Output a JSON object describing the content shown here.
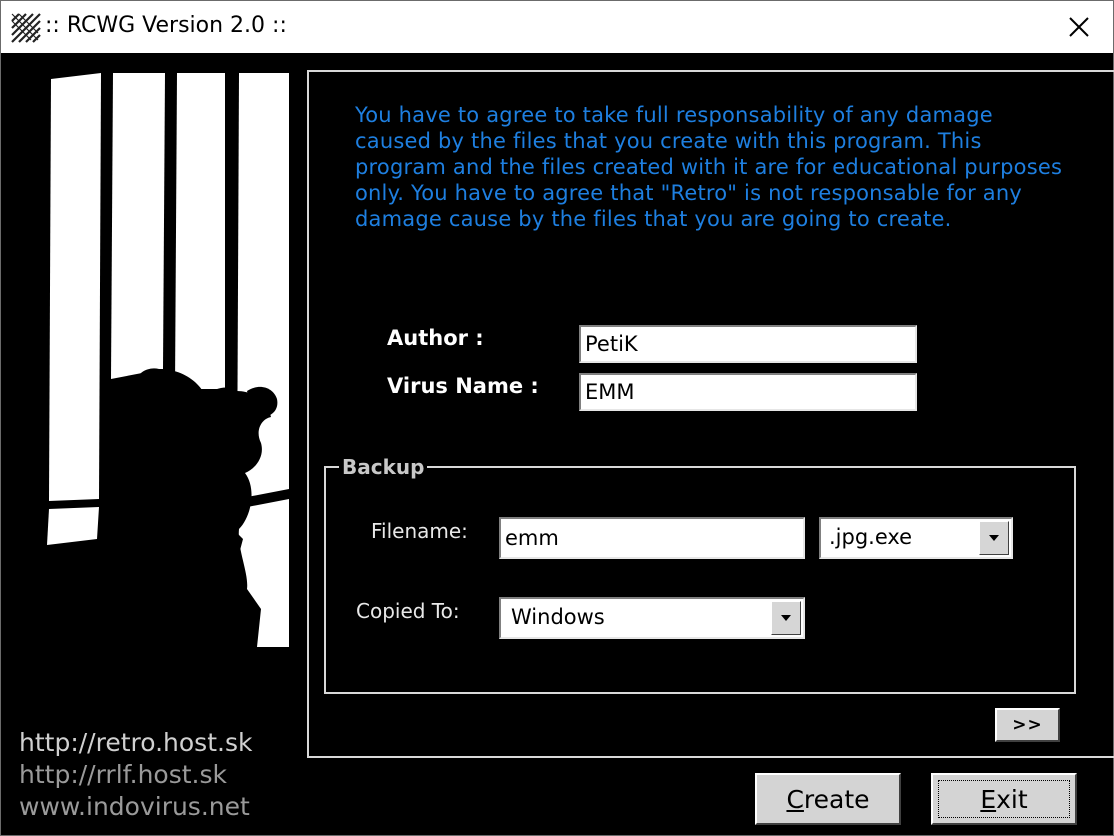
{
  "window": {
    "title": ":: RCWG Version 2.0 ::",
    "title_icon": "rcwg-app-icon",
    "close_icon": "close-icon"
  },
  "disclaimer": "You have to agree to take full responsability of any damage caused by the files that you create with this program. This program and the files created with it are for educational purposes only. You have to agree that \"Retro\" is not responsable for any damage cause by the files that you are going to create.",
  "form": {
    "author_label": "Author :",
    "author_value": "PetiK",
    "virus_name_label": "Virus Name :",
    "virus_name_value": "EMM"
  },
  "backup": {
    "group_title": "Backup",
    "filename_label": "Filename:",
    "filename_value": "emm",
    "extension_selected": ".jpg.exe",
    "copied_to_label": "Copied To:",
    "copied_to_selected": "Windows"
  },
  "buttons": {
    "next_label": ">>",
    "create_label_first": "C",
    "create_label_rest": "reate",
    "exit_label_first": "E",
    "exit_label_rest": "xit"
  },
  "links": {
    "link1": "http://retro.host.sk",
    "link2": "http://rrlf.host.sk",
    "link3": "www.indovirus.net"
  },
  "colors": {
    "disclaimer_text": "#1e7fe0",
    "background": "#000000"
  }
}
